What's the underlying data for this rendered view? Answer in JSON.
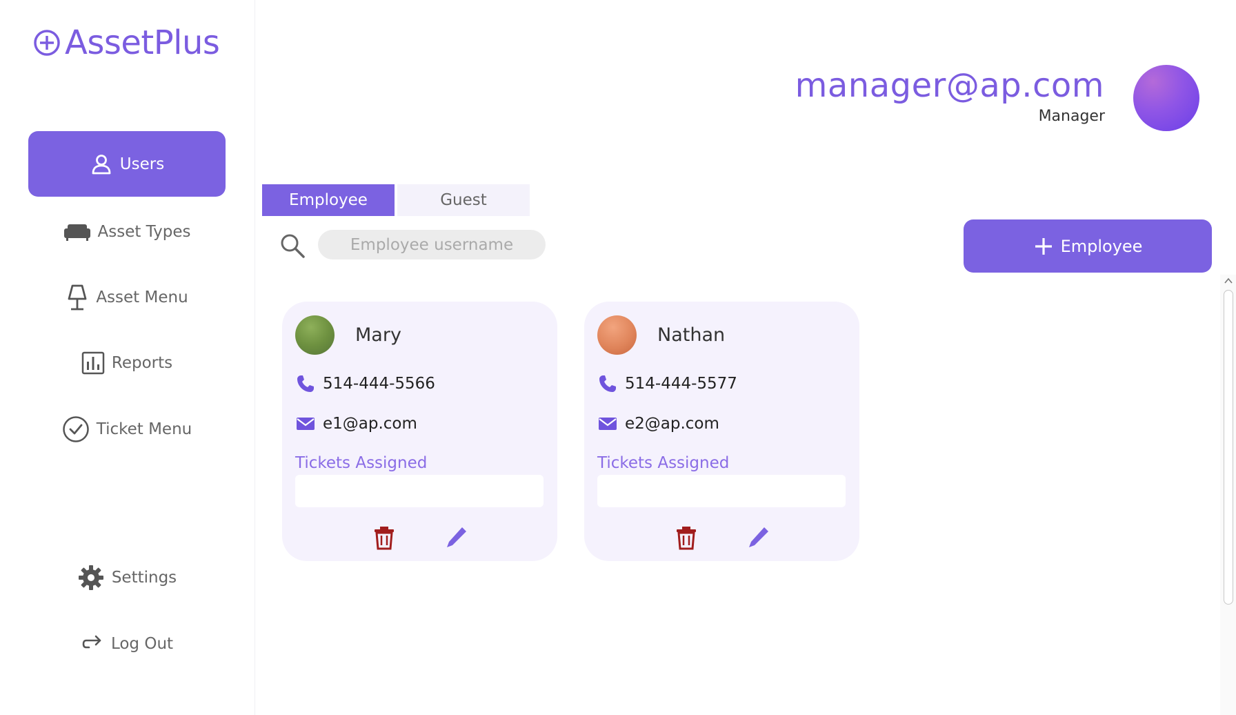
{
  "app": {
    "name": "AssetPlus"
  },
  "sidebar": {
    "items": [
      {
        "label": "Users",
        "icon": "user-icon",
        "active": true
      },
      {
        "label": "Asset Types",
        "icon": "sofa-icon"
      },
      {
        "label": "Asset Menu",
        "icon": "lamp-icon"
      },
      {
        "label": "Reports",
        "icon": "bar-chart-icon"
      },
      {
        "label": "Ticket Menu",
        "icon": "check-circle-icon"
      }
    ],
    "bottom": [
      {
        "label": "Settings",
        "icon": "gear-icon"
      },
      {
        "label": "Log Out",
        "icon": "logout-arrow-icon"
      }
    ]
  },
  "header": {
    "email": "manager@ap.com",
    "role": "Manager"
  },
  "tabs": [
    {
      "label": "Employee",
      "active": true
    },
    {
      "label": "Guest",
      "active": false
    }
  ],
  "search": {
    "placeholder": "Employee username"
  },
  "add_button": {
    "label": "Employee"
  },
  "employees": [
    {
      "name": "Mary",
      "phone": "514-444-5566",
      "email": "e1@ap.com",
      "tickets_label": "Tickets Assigned"
    },
    {
      "name": "Nathan",
      "phone": "514-444-5577",
      "email": "e2@ap.com",
      "tickets_label": "Tickets Assigned"
    }
  ],
  "colors": {
    "accent": "#7b62e1",
    "card_bg": "#f5f2fd",
    "delete": "#a11d1d"
  }
}
